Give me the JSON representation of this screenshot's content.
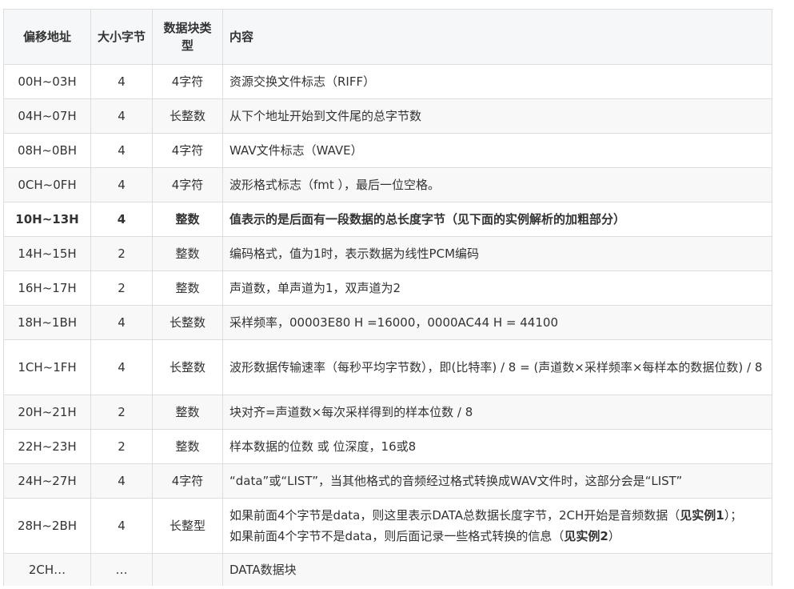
{
  "header": {
    "col1": "偏移地址",
    "col2": "大小字节",
    "col3": "数据块类型",
    "col4": "内容"
  },
  "rows": [
    {
      "offset": "00H~03H",
      "size": "4",
      "type": "4字符",
      "content": "资源交换文件标志（RIFF）"
    },
    {
      "offset": "04H~07H",
      "size": "4",
      "type": "长整数",
      "content": "从下个地址开始到文件尾的总字节数"
    },
    {
      "offset": "08H~0BH",
      "size": "4",
      "type": "4字符",
      "content": "WAV文件标志（WAVE）"
    },
    {
      "offset": "0CH~0FH",
      "size": "4",
      "type": "4字符",
      "content": "波形格式标志（fmt ），最后一位空格。"
    },
    {
      "offset": "10H~13H",
      "size": "4",
      "type": "整数",
      "content": "值表示的是后面有一段数据的总长度字节（见下面的实例解析的加粗部分）"
    },
    {
      "offset": "14H~15H",
      "size": "2",
      "type": "整数",
      "content": "编码格式，值为1时，表示数据为线性PCM编码"
    },
    {
      "offset": "16H~17H",
      "size": "2",
      "type": "整数",
      "content": "声道数，单声道为1，双声道为2"
    },
    {
      "offset": "18H~1BH",
      "size": "4",
      "type": "长整数",
      "content": "采样频率，00003E80 H =16000，0000AC44 H = 44100"
    },
    {
      "offset": "1CH~1FH",
      "size": "4",
      "type": "长整数",
      "content": "波形数据传输速率（每秒平均字节数），即(比特率) / 8 = (声道数×采样频率×每样本的数据位数) / 8"
    },
    {
      "offset": "20H~21H",
      "size": "2",
      "type": "整数",
      "content": "块对齐=声道数×每次采样得到的样本位数 / 8"
    },
    {
      "offset": "22H~23H",
      "size": "2",
      "type": "整数",
      "content": "样本数据的位数 或 位深度，16或8"
    },
    {
      "offset": "24H~27H",
      "size": "4",
      "type": "4字符",
      "content": "“data”或“LIST”，当其他格式的音频经过格式转换成WAV文件时，这部分会是“LIST”"
    },
    {
      "offset": "28H~2BH",
      "size": "4",
      "type": "长整型",
      "content_line1_a": "如果前面4个字节是data，则这里表示DATA总数据长度字节，2CH开始是音频数据（",
      "content_line1_b": "见实例1",
      "content_line1_c": "）；",
      "content_line2_a": "如果前面4个字节不是data，则后面记录一些格式转换的信息（",
      "content_line2_b": "见实例2",
      "content_line2_c": "）"
    },
    {
      "offset": "2CH…",
      "size": "…",
      "type": "",
      "content": "DATA数据块"
    }
  ]
}
